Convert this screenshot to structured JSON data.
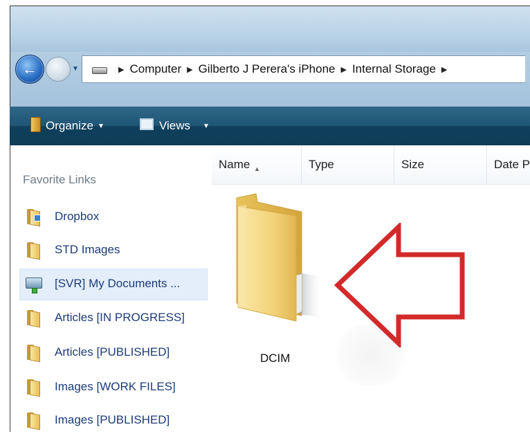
{
  "address_bar": {
    "breadcrumbs": [
      "Computer",
      "Gilberto J Perera's iPhone",
      "Internal Storage"
    ]
  },
  "toolbar": {
    "organize_label": "Organize",
    "views_label": "Views"
  },
  "sidebar": {
    "title": "Favorite Links",
    "items": [
      {
        "label": "Dropbox",
        "icon": "dropbox-folder-icon"
      },
      {
        "label": "STD Images",
        "icon": "folder-icon"
      },
      {
        "label": "[SVR] My Documents ...",
        "icon": "network-drive-icon",
        "selected": true
      },
      {
        "label": "Articles [IN PROGRESS]",
        "icon": "folder-icon"
      },
      {
        "label": "Articles [PUBLISHED]",
        "icon": "folder-icon"
      },
      {
        "label": "Images [WORK FILES]",
        "icon": "folder-icon"
      },
      {
        "label": "Images [PUBLISHED]",
        "icon": "folder-icon"
      }
    ]
  },
  "file_list": {
    "columns": [
      "Name",
      "Type",
      "Size",
      "Date P"
    ],
    "items": [
      {
        "name": "DCIM",
        "icon": "folder-icon"
      }
    ]
  },
  "annotation": {
    "icon": "arrow-outline",
    "color": "#d22a2a"
  },
  "colors": {
    "toolbar": "#1f5575",
    "link_text": "#1c3b7a",
    "selection": "#e3eefa"
  }
}
